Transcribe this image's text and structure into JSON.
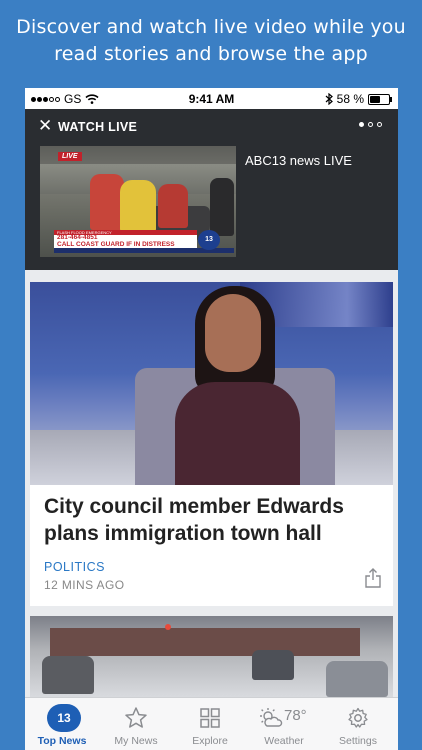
{
  "promo": {
    "line1": "Discover and watch live video while you",
    "line2": "read stories and browse the app"
  },
  "status_bar": {
    "carrier": "GS",
    "time": "9:41 AM",
    "battery": "58 %",
    "battery_level": 0.58
  },
  "live_panel": {
    "close_icon": "close-icon",
    "title": "WATCH LIVE",
    "page_count": 3,
    "active_page": 0,
    "headline": "ABC13 news LIVE",
    "video": {
      "live_badge": "LIVE",
      "banner_top": "FLASH FLOOD EMERGENCY",
      "banner_phone": "281-464-4851",
      "banner_text": "CALL COAST GUARD IF IN DISTRESS",
      "logo": "13"
    }
  },
  "stories": [
    {
      "title": "City council member Edwards plans immigration town hall",
      "category": "POLITICS",
      "time": "12 MINS AGO",
      "share_icon": "share-icon"
    }
  ],
  "tab_bar": {
    "tabs": [
      {
        "label": "Top News",
        "icon": "abc13-logo-icon",
        "logo_text": "13",
        "active": true
      },
      {
        "label": "My News",
        "icon": "star-icon",
        "active": false
      },
      {
        "label": "Explore",
        "icon": "grid-icon",
        "active": false
      },
      {
        "label": "Weather",
        "icon": "sun-cloud-icon",
        "temp": "78°",
        "active": false
      },
      {
        "label": "Settings",
        "icon": "gear-icon",
        "active": false
      }
    ]
  },
  "colors": {
    "background": "#3b7fc4",
    "accent": "#1e5fb5",
    "category": "#2a78c5",
    "live_panel": "#2a2d31"
  }
}
